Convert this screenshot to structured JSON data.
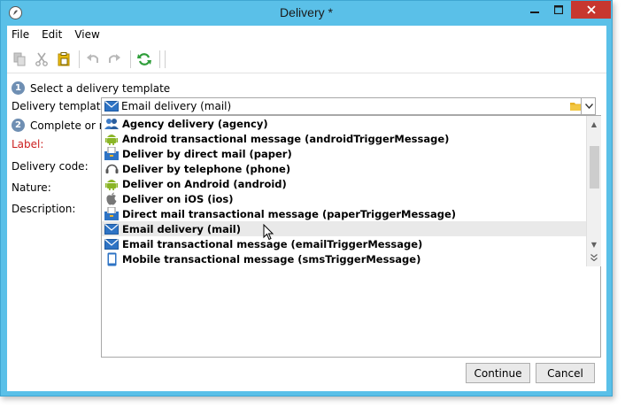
{
  "window": {
    "title": "Delivery *"
  },
  "menu": {
    "items": [
      "File",
      "Edit",
      "View"
    ]
  },
  "toolbar": {
    "icons": [
      "copy-icon",
      "cut-icon",
      "paste-icon",
      "undo-icon",
      "redo-icon",
      "refresh-icon"
    ]
  },
  "steps": {
    "step1": {
      "num": "1",
      "label": "Select a delivery template"
    },
    "step2": {
      "num": "2",
      "label": "Complete or m"
    }
  },
  "form": {
    "template_label": "Delivery template:",
    "template_value": "Email delivery (mail)",
    "label_label": "Label:",
    "code_label": "Delivery code:",
    "nature_label": "Nature:",
    "description_label": "Description:"
  },
  "dropdown": {
    "items": [
      {
        "label": "Agency delivery (agency)",
        "icon": "agency-icon"
      },
      {
        "label": "Android transactional message (androidTriggerMessage)",
        "icon": "android-icon"
      },
      {
        "label": "Deliver by direct mail (paper)",
        "icon": "mailbox-icon"
      },
      {
        "label": "Deliver by telephone (phone)",
        "icon": "headset-icon"
      },
      {
        "label": "Deliver on Android (android)",
        "icon": "android-icon"
      },
      {
        "label": "Deliver on iOS (ios)",
        "icon": "apple-icon"
      },
      {
        "label": "Direct mail transactional message (paperTriggerMessage)",
        "icon": "mailbox-icon"
      },
      {
        "label": "Email delivery (mail)",
        "icon": "envelope-icon"
      },
      {
        "label": "Email transactional message (emailTriggerMessage)",
        "icon": "envelope-icon"
      },
      {
        "label": "Mobile transactional message (smsTriggerMessage)",
        "icon": "mobile-icon"
      }
    ],
    "highlighted_index": 7
  },
  "buttons": {
    "continue": "Continue",
    "cancel": "Cancel"
  },
  "colors": {
    "window_frame": "#5ac0e8",
    "close_button": "#c7372f",
    "required_label": "#cc1f1f",
    "step_badge": "#6f8fb3",
    "highlight": "#e9e9e9"
  }
}
